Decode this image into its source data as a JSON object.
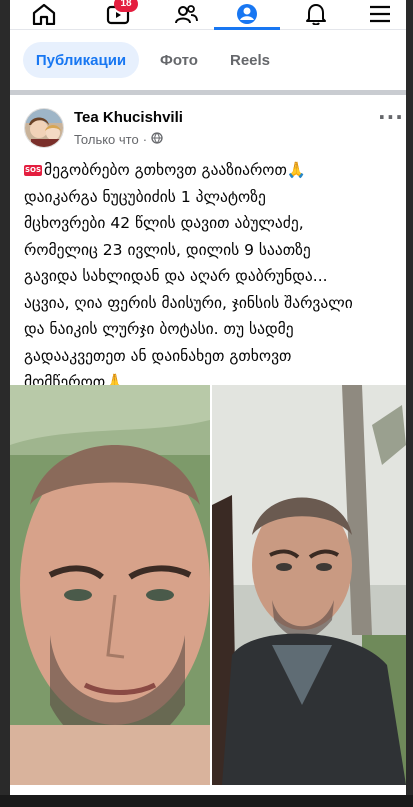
{
  "nav": {
    "icons": [
      "home-icon",
      "video-icon",
      "friends-icon",
      "profile-icon",
      "bell-icon",
      "menu-icon"
    ],
    "video_badge": "18",
    "active": "profile-icon"
  },
  "tabs": [
    {
      "label": "Публикации",
      "active": true
    },
    {
      "label": "Фото",
      "active": false
    },
    {
      "label": "Reels",
      "active": false
    }
  ],
  "post": {
    "author": "Tea Khucishvili",
    "time": "Только что",
    "sos_badge": "SOS",
    "body": "მეგობრებო გთხოვთ გააზიაროთ🙏\nდაიკარგა ნუცუბიძის 1 პლატოზე\nმცხოვრები 42 წლის დავით აბულაძე,\nრომელიც 23 ივლის, დილის 9 საათზე\nგავიდა სახლიდან და აღარ დაბრუნდა...\nაცვია, ღია ფერის მაისური, ჯინსის შარვალი\nდა ნაიკის ლურჯი ბოტასი. თუ სადმე\nგადააკვეთეთ ან დაინახეთ გთხოვთ\nმომწეროთ🙏",
    "photos": [
      "photo-man-outdoor-left",
      "photo-man-outdoor-right"
    ]
  },
  "colors": {
    "accent": "#1877f2",
    "badge": "#e41e3f",
    "tab_active_bg": "#e7f0fd",
    "secondary_text": "#65676b"
  }
}
